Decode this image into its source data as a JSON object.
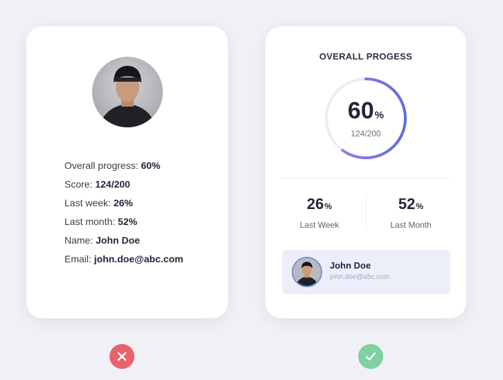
{
  "left_card": {
    "rows": [
      {
        "label": "Overall progress: ",
        "value": "60%"
      },
      {
        "label": "Score: ",
        "value": "124/200"
      },
      {
        "label": "Last week: ",
        "value": "26%"
      },
      {
        "label": "Last month: ",
        "value": "52%"
      },
      {
        "label": "Name: ",
        "value": "John Doe"
      },
      {
        "label": "Email: ",
        "value": "john.doe@abc.com"
      }
    ]
  },
  "right_card": {
    "title": "OVERALL PROGESS",
    "progress": {
      "value": "60",
      "unit": "%",
      "fraction": 0.6,
      "score": "124/200"
    },
    "stats": {
      "week": {
        "value": "26",
        "unit": "%",
        "label": "Last Week"
      },
      "month": {
        "value": "52",
        "unit": "%",
        "label": "Last Month"
      }
    },
    "user": {
      "name": "John Doe",
      "email": "john.doe@abc.com"
    }
  },
  "icons": {
    "bad": "close-icon",
    "good": "check-icon"
  },
  "colors": {
    "ring_start": "#a77ce6",
    "ring_end": "#5b6fd9",
    "ring_track": "#ececf7",
    "bad": "#e9636b",
    "good": "#7fd1a0"
  }
}
